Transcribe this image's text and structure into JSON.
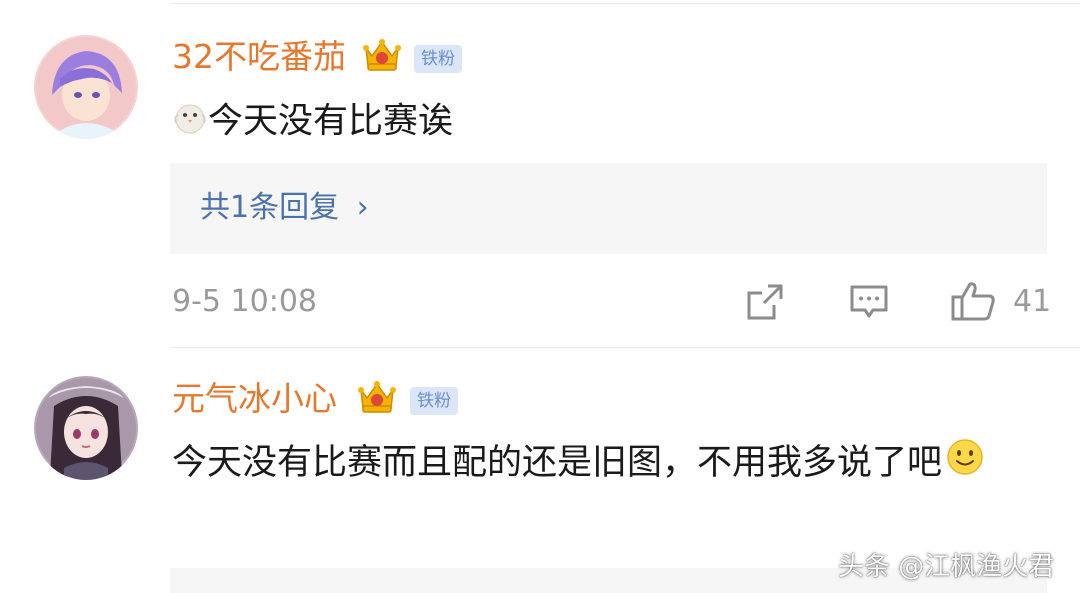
{
  "comments": [
    {
      "username": "32不吃番茄",
      "badge": "铁粉",
      "text": "今天没有比赛诶",
      "reply_summary": "共1条回复",
      "reply_chevron": "›",
      "timestamp": "9-5 10:08",
      "like_count": "41",
      "inline_icon": "bird-emoji-icon"
    },
    {
      "username": "元气冰小心",
      "badge": "铁粉",
      "text": "今天没有比赛而且配的还是旧图，不用我多说了吧",
      "inline_icon": "smile-emoji-icon"
    }
  ],
  "watermark": "头条 @江枫渔火君",
  "colors": {
    "username": "#e8772e",
    "badge_bg": "#dbe6f8",
    "badge_text": "#6a8fd6",
    "reply_link": "#4a72ad",
    "meta_text": "#9a9a9a",
    "reply_box_bg": "#f6f6f6"
  },
  "icons": [
    "crown-icon",
    "share-icon",
    "comment-icon",
    "thumbs-up-icon"
  ]
}
